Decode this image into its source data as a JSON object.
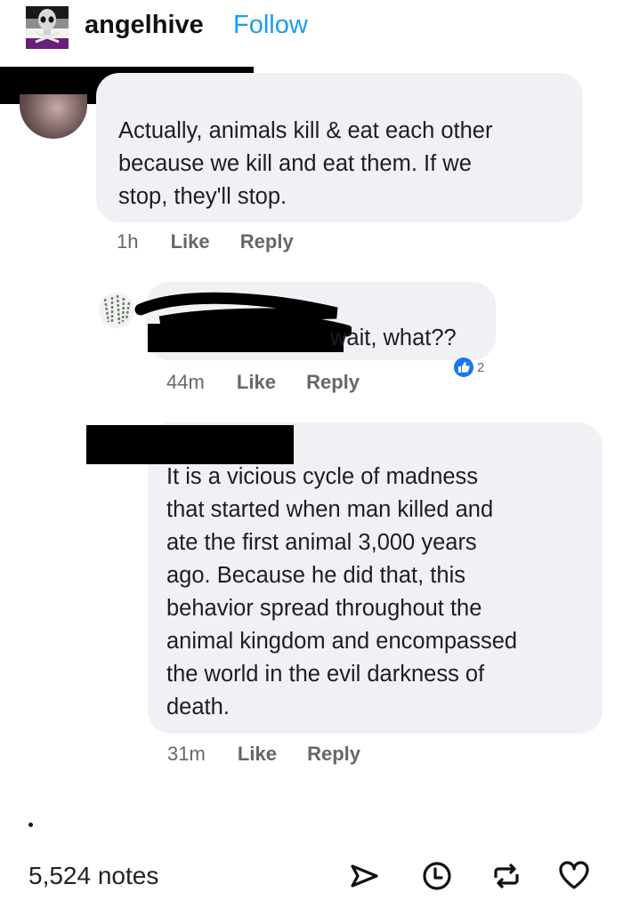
{
  "post": {
    "username": "angelhive",
    "follow_label": "Follow"
  },
  "comments": [
    {
      "lines": [
        "Actually, animals kill & eat each other",
        "because we kill and eat them. If we",
        "stop, they'll stop."
      ],
      "time": "1h",
      "like": "Like",
      "reply": "Reply"
    },
    {
      "lines": [
        "wait, what??"
      ],
      "time": "44m",
      "like": "Like",
      "reply": "Reply",
      "reaction_count": "2"
    },
    {
      "lines": [
        "It is a vicious cycle of madness",
        "that started when man killed and",
        "ate the first animal 3,000 years",
        "ago. Because he did that, this",
        "behavior spread throughout the",
        "animal kingdom and encompassed",
        "the world in the evil darkness of",
        "death."
      ],
      "time": "31m",
      "like": "Like",
      "reply": "Reply"
    }
  ],
  "footer": {
    "dot": ".",
    "notes": "5,524 notes",
    "icons": [
      "share-icon",
      "clock-icon",
      "reblog-icon",
      "heart-icon"
    ]
  },
  "colors": {
    "follow": "#1a9df0",
    "bubble": "#eff1f4",
    "like_reaction": "#1877f2"
  }
}
